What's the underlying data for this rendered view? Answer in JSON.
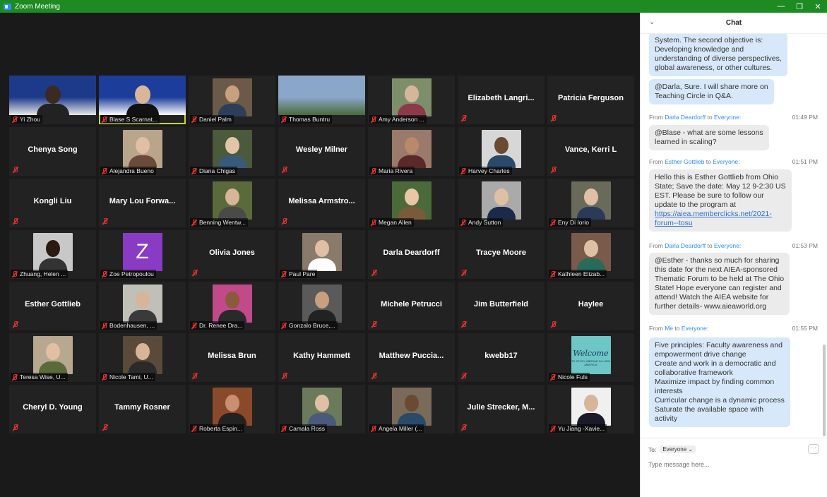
{
  "window": {
    "title": "Zoom Meeting",
    "minimize": "—",
    "restore": "❐",
    "close": "✕"
  },
  "tiles": [
    {
      "kind": "wide",
      "label": "Yi Zhou",
      "colors": [
        "#1d3a8a",
        "#e8e8e8"
      ],
      "head": "#3a2a20",
      "body": "#222"
    },
    {
      "kind": "wide",
      "label": "Blase S Scarnat...",
      "colors": [
        "#1c3d9a",
        "#ffffff"
      ],
      "head": "#d9b69a",
      "body": "#111",
      "active": true
    },
    {
      "kind": "photo",
      "label": "Daniel Palm",
      "bg": "#6b5a48",
      "head": "#c8a080",
      "body": "#2c3e5a"
    },
    {
      "kind": "wide",
      "label": "Thomas Buntru",
      "colors": [
        "#8aa6c8",
        "#4a6a3a"
      ],
      "head": null
    },
    {
      "kind": "photo",
      "label": "Amy Anderson ...",
      "bg": "#7d8f6a",
      "head": "#d7b59a",
      "body": "#8c3a4a"
    },
    {
      "kind": "name",
      "name": "Elizabeth Langri...",
      "label": ""
    },
    {
      "kind": "name",
      "name": "Patricia Ferguson",
      "label": ""
    },
    {
      "kind": "name",
      "name": "Chenya Song",
      "label": ""
    },
    {
      "kind": "photo",
      "label": "Alejandra Bueno",
      "bg": "#b9a58a",
      "head": "#e0bfa4",
      "body": "#6a4a3a"
    },
    {
      "kind": "photo",
      "label": "Diana Chigas",
      "bg": "#4a5a3a",
      "head": "#e3c6a8",
      "body": "#3a5a7a"
    },
    {
      "kind": "name",
      "name": "Wesley Milner",
      "label": ""
    },
    {
      "kind": "photo",
      "label": "Maria Rivera",
      "bg": "#9a7a6a",
      "head": "#b98a6a",
      "body": "#5a2a2a"
    },
    {
      "kind": "photo",
      "label": "Harvey Charles",
      "bg": "#d7d7d7",
      "head": "#6a4a30",
      "body": "#2a4a6a"
    },
    {
      "kind": "name",
      "name": "Vance, Kerri L",
      "label": ""
    },
    {
      "kind": "name",
      "name": "Kongli Liu",
      "label": ""
    },
    {
      "kind": "name",
      "name": "Mary Lou Forwa...",
      "label": ""
    },
    {
      "kind": "photo",
      "label": "Benning Wentw...",
      "bg": "#5a6a3a",
      "head": "#d8b498",
      "body": "#4a4a4a"
    },
    {
      "kind": "name",
      "name": "Melissa Armstro...",
      "label": ""
    },
    {
      "kind": "photo",
      "label": "Megan Allen",
      "bg": "#4a6a3a",
      "head": "#e8c6a6",
      "body": "#7a5a3a"
    },
    {
      "kind": "photo",
      "label": "Andy Sutton",
      "bg": "#aaaaaa",
      "head": "#e0c0a4",
      "body": "#1a2a4a"
    },
    {
      "kind": "photo",
      "label": "Eny Di Iorio",
      "bg": "#6a6a5a",
      "head": "#e0c0a4",
      "body": "#2a3a5a"
    },
    {
      "kind": "photo",
      "label": "Zhuang, Helen ...",
      "bg": "#c8c8c8",
      "head": "#2a1a10",
      "body": "#333"
    },
    {
      "kind": "avatar",
      "letter": "Z",
      "label": "Zoe Petropoulou"
    },
    {
      "kind": "name",
      "name": "Olivia Jones",
      "label": ""
    },
    {
      "kind": "photo",
      "label": "Paul Pare",
      "bg": "#8a7a6a",
      "head": "#e0bfa4",
      "body": "#ffffff"
    },
    {
      "kind": "name",
      "name": "Darla Deardorff",
      "label": ""
    },
    {
      "kind": "name",
      "name": "Tracye Moore",
      "label": ""
    },
    {
      "kind": "photo",
      "label": "Kathleen Elizab...",
      "bg": "#7a5a4a",
      "head": "#e0c0a4",
      "body": "#2a6a5a"
    },
    {
      "kind": "name",
      "name": "Esther Gottlieb",
      "label": ""
    },
    {
      "kind": "photo",
      "label": "Bodenhausen, ...",
      "bg": "#c0c0b8",
      "head": "#d8b498",
      "body": "#3a3a3a"
    },
    {
      "kind": "photo",
      "label": "Dr. Renee Dra...",
      "bg": "#c04a8a",
      "head": "#8a5a3a",
      "body": "#2a2a2a"
    },
    {
      "kind": "photo",
      "label": "Gonzalo Bruce,...",
      "bg": "#5a5a5a",
      "head": "#c8a080",
      "body": "#222"
    },
    {
      "kind": "name",
      "name": "Michele Petrucci",
      "label": ""
    },
    {
      "kind": "name",
      "name": "Jim Butterfield",
      "label": ""
    },
    {
      "kind": "name",
      "name": "Haylee",
      "label": ""
    },
    {
      "kind": "photo",
      "label": "Teresa Wise, U...",
      "bg": "#b8a890",
      "head": "#e0c0a4",
      "body": "#5a6a3a"
    },
    {
      "kind": "photo",
      "label": "Nicole Tami, U...",
      "bg": "#5a4a3a",
      "head": "#d8b498",
      "body": "#2a2a2a"
    },
    {
      "kind": "name",
      "name": "Melissa Brun",
      "label": ""
    },
    {
      "kind": "name",
      "name": "Kathy Hammett",
      "label": ""
    },
    {
      "kind": "name",
      "name": "Matthew  Puccia...",
      "label": ""
    },
    {
      "kind": "name",
      "name": "kwebb17",
      "label": ""
    },
    {
      "kind": "welcome",
      "label": "Nicole Fuls",
      "title": "Welcome",
      "sub": "TO STUDY ABROAD IN LATIN AMERICA"
    },
    {
      "kind": "name",
      "name": "Cheryl D. Young",
      "label": ""
    },
    {
      "kind": "name",
      "name": "Tammy Rosner",
      "label": ""
    },
    {
      "kind": "photo",
      "label": "Roberta Espin...",
      "bg": "#8a4a2a",
      "head": "#c89070",
      "body": "#222"
    },
    {
      "kind": "photo",
      "label": "Camala Ross",
      "bg": "#6a7a5a",
      "head": "#e0c0a4",
      "body": "#4a5a7a"
    },
    {
      "kind": "photo",
      "label": "Angela Miller (...",
      "bg": "#7a6a5a",
      "head": "#6a4a30",
      "body": "#2a4a6a"
    },
    {
      "kind": "name",
      "name": "Julie Strecker, M...",
      "label": ""
    },
    {
      "kind": "photo",
      "label": "Yu Jiang -Xavie...",
      "bg": "#f0f0f0",
      "head": "#d8b498",
      "body": "#1a1a2a"
    }
  ],
  "chat": {
    "title": "Chat",
    "messages": [
      {
        "text_lines": [
          "System. The second objective is:",
          "Developing knowledge and",
          "understanding of diverse perspectives,",
          "global awareness, or other cultures."
        ]
      },
      {
        "text_lines": [
          "@Darla, Sure. I will share more on",
          "Teaching Circle in Q&A."
        ]
      },
      {
        "from": "Darla Deardorff",
        "to": "Everyone",
        "time": "01:49 PM",
        "text_lines": [
          "@Blase - what are some lessons",
          "learned in scaling?"
        ]
      },
      {
        "from": "Esther Gottlieb",
        "to": "Everyone",
        "time": "01:51 PM",
        "text_lines": [
          "Hello this is Esther Gottlieb from Ohio",
          "State; Save the date: May 12 9-2:30 US",
          "EST. Please be sure to follow our",
          "update to the program at"
        ],
        "link_lines": [
          "https://aiea.memberclicks.net/2021-",
          "forum--tosu"
        ]
      },
      {
        "from": "Darla Deardorff",
        "to": "Everyone",
        "time": "01:53 PM",
        "text_lines": [
          "@Esther - thanks so much for sharing",
          "this date for the next AIEA-sponsored",
          "Thematic Forum to be held at The Ohio",
          "State!  Hope everyone can register and",
          "attend! Watch the AIEA website for",
          "further details- www.aieaworld.org"
        ]
      },
      {
        "from": "Me",
        "to": "Everyone",
        "time": "01:55 PM",
        "text_lines": [
          "Five principles: Faculty awareness and",
          "empowerment drive change",
          "Create and work in a democratic and",
          "collaborative framework",
          "Maximize impact by finding common",
          "interests",
          "Curricular change is a dynamic process",
          "Saturate the available space with",
          "activity"
        ]
      }
    ],
    "from_word": "From",
    "to_word": "to",
    "to_label": "To:",
    "recipient": "Everyone",
    "placeholder": "Type message here..."
  }
}
